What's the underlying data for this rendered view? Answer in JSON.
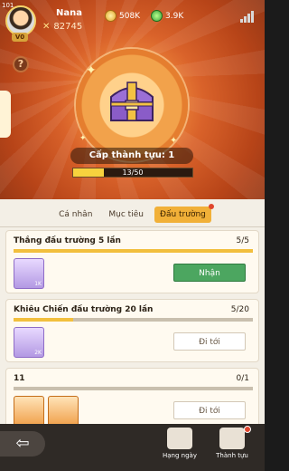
{
  "profile": {
    "level": "101",
    "name": "Nana",
    "vip": "V0",
    "power": "82745"
  },
  "currency": {
    "gold": "508K",
    "gems": "3.9K"
  },
  "achievement": {
    "rank_label": "Cấp thành tựu: 1",
    "progress_text": "13/50",
    "progress_fraction": 0.26
  },
  "tabs": [
    {
      "label": "Cá nhân"
    },
    {
      "label": "Mục tiêu"
    },
    {
      "label": "Đấu trường"
    }
  ],
  "quests": [
    {
      "title": "Thắng đấu trường 5 lần",
      "count": "5/5",
      "progress_fraction": 1.0,
      "rewards": [
        {
          "qty": "1K",
          "icon": "scroll-icon"
        }
      ],
      "action": "Nhận"
    },
    {
      "title": "Khiêu Chiến đấu trường 20 lần",
      "count": "5/20",
      "progress_fraction": 0.25,
      "rewards": [
        {
          "qty": "2K",
          "icon": "scroll-icon"
        }
      ],
      "action": "Đi tới"
    },
    {
      "title": "11",
      "count": "0/1",
      "progress_fraction": 0.0,
      "rewards": [
        {
          "qty": "",
          "icon": "green-token-icon"
        },
        {
          "qty": "",
          "icon": "chest-icon"
        }
      ],
      "action": "Đi tới"
    }
  ],
  "footer": {
    "ranking_label": "Hạng ngày",
    "achievements_label": "Thành tựu"
  }
}
